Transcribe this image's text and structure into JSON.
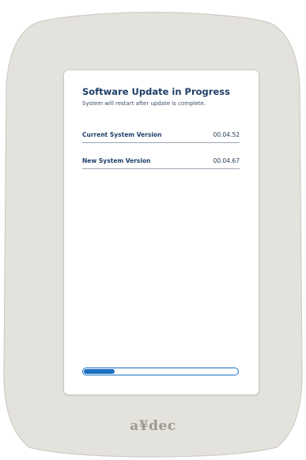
{
  "device": {
    "brand": "a-dec",
    "colors": {
      "bezel": "#e4e2dd",
      "bezel_outline": "#cfccc5",
      "accent": "#1c6fc0",
      "title_text": "#1f3f67"
    }
  },
  "screen": {
    "title": "Software Update in Progress",
    "subtitle": "System will restart after update is complete.",
    "rows": [
      {
        "label": "Current System Version",
        "value": "00.04.52"
      },
      {
        "label": "New System Version",
        "value": "00.04.67"
      }
    ],
    "progress": {
      "fraction": 0.2
    }
  }
}
